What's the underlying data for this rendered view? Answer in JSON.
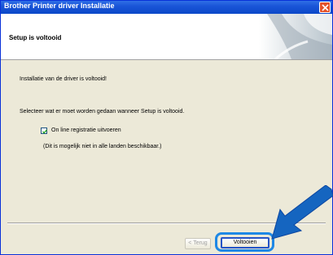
{
  "window": {
    "title": "Brother Printer driver Installatie"
  },
  "header": {
    "title": "Setup is voltooid"
  },
  "content": {
    "line1": "Installatie van de driver is voltooid!",
    "line2": "Selecteer wat er moet worden gedaan wanneer Setup is voltooid.",
    "checkbox_label": "On line registratie uitvoeren",
    "checkbox_checked": true,
    "note": "(Dit is mogelijk niet in alle landen beschikbaar.)"
  },
  "buttons": {
    "back": "< Terug",
    "finish": "Voltooien"
  },
  "colors": {
    "titlebar": "#0b48c8",
    "close": "#e4532b",
    "highlight": "#1e88e5",
    "arrow": "#1565c0"
  }
}
